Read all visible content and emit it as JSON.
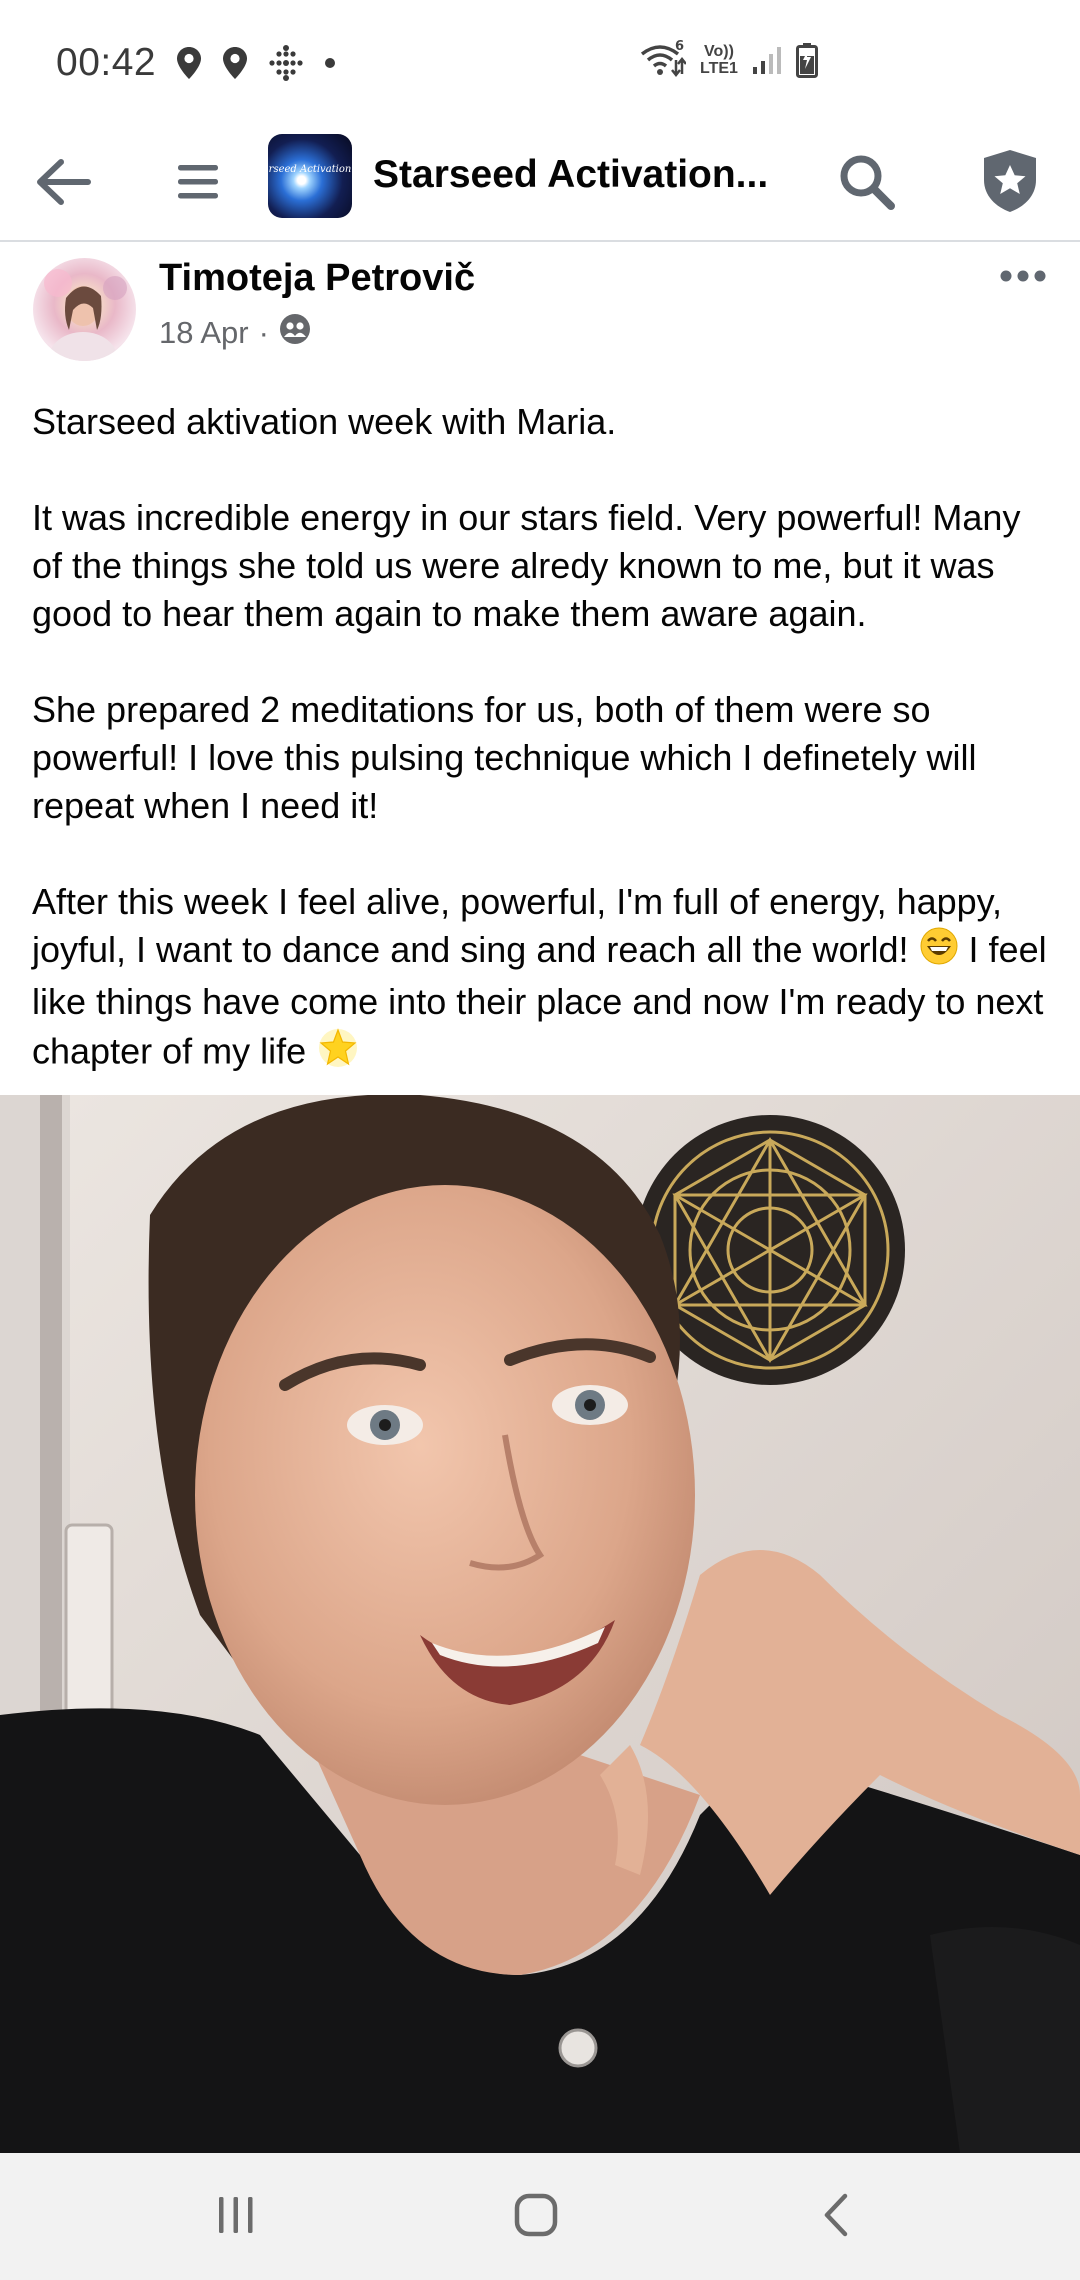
{
  "status_bar": {
    "time": "00:42",
    "wifi_label": "6",
    "volte_top": "Vo))",
    "volte_bottom": "LTE1",
    "icons": [
      "location-icon",
      "location-icon",
      "activity-dots-icon",
      "dot-icon",
      "wifi-icon",
      "volte-icon",
      "signal-icon",
      "battery-icon"
    ]
  },
  "header": {
    "back_icon": "back-arrow-icon",
    "menu_icon": "hamburger-menu-icon",
    "group_thumb_text": "rseed Activation",
    "group_title": "Starseed Activation...",
    "search_icon": "search-icon",
    "badge_icon": "shield-star-icon"
  },
  "post": {
    "author": "Timoteja Petrovič",
    "date": "18 Apr",
    "separator": "·",
    "audience_icon": "group-members-icon",
    "more_icon": "more-horizontal-icon",
    "paragraphs": [
      "Starseed aktivation week with Maria.",
      "It was incredible energy in our stars field. Very powerful! Many of the things she told us were alredy known to me, but it was good to hear them again to make them aware again.",
      "She prepared 2 meditations for us, both of them were so powerful! I love this pulsing technique which I definetely will repeat when I need it!"
    ],
    "last_paragraph_part1": "After this week I feel alive, powerful, I'm full of energy, happy, joyful, I want to dance and sing and reach all the world! ",
    "last_paragraph_part2": " I feel like things have come into their place and now I'm ready to next chapter of my life ",
    "emoji_1": "grinning-face-emoji",
    "emoji_2": "glowing-star-emoji",
    "photo": "selfie-photo"
  },
  "nav_bar": {
    "recents_icon": "recents-icon",
    "home_icon": "home-icon",
    "back_icon": "back-chevron-icon"
  },
  "colors": {
    "text": "#050505",
    "secondary_text": "#65676b",
    "icon": "#65676b",
    "divider": "#dadde1",
    "nav_bg": "#f2f2f2"
  }
}
